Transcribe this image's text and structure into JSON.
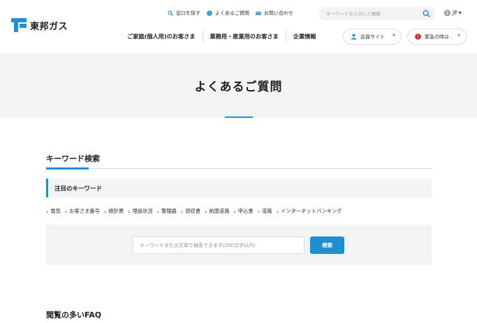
{
  "header": {
    "logo_text": "東邦ガス",
    "utility_links": [
      {
        "label": "窓口を探す",
        "icon": "search-icon"
      },
      {
        "label": "よくあるご質問",
        "icon": "info-icon"
      },
      {
        "label": "お問い合わせ",
        "icon": "mail-icon"
      }
    ],
    "search_placeholder": "キーワードを入力して検索",
    "language": "JP",
    "main_nav": [
      "ご家庭(個人用)のお客さま",
      "業務用・産業用のお客さま",
      "企業情報"
    ],
    "member_site_label": "会員サイト",
    "emergency_label": "緊急の時は"
  },
  "hero": {
    "title": "よくあるご質問"
  },
  "keyword_search": {
    "heading": "キーワード検索",
    "featured_label": "注目のキーワード",
    "keywords": [
      "電気",
      "お客さま番号",
      "検針票",
      "埋設状況",
      "警報器",
      "領収書",
      "前面道路",
      "申込書",
      "道路",
      "インターネットバンキング"
    ],
    "input_placeholder": "キーワードまたは文章で検索できます(200文字以内)",
    "submit_label": "検索"
  },
  "faq": {
    "heading": "閲覧の多いFAQ"
  },
  "colors": {
    "accent": "#1f8fcf",
    "panel_bg": "#f2f3f4",
    "emergency_red": "#d0242b"
  }
}
